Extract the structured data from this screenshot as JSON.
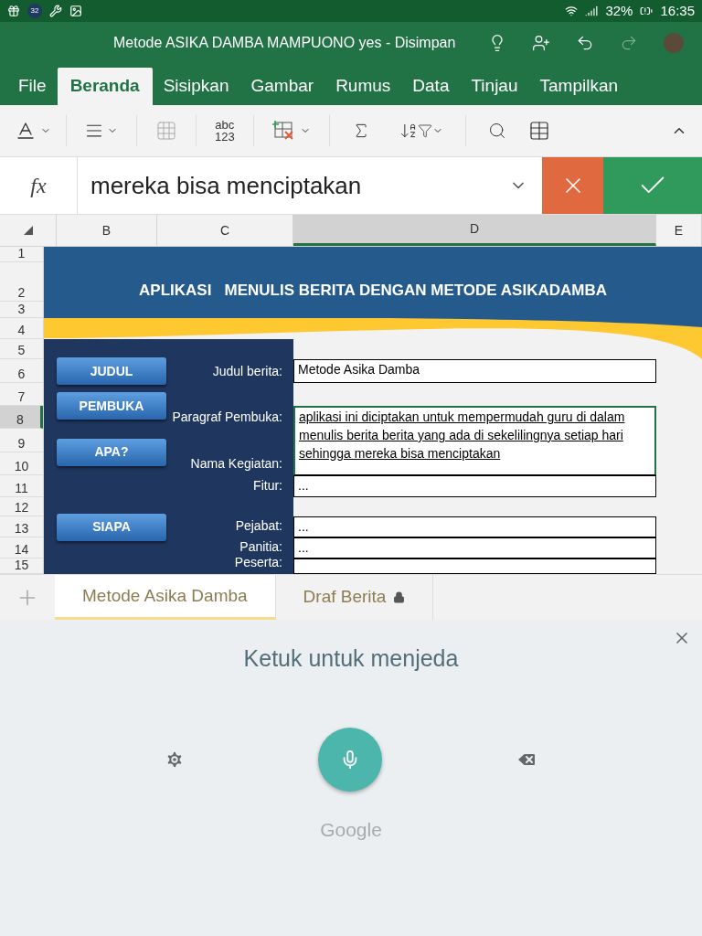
{
  "status_bar": {
    "notification_count": "32",
    "battery": "32%",
    "time": "16:35"
  },
  "title_bar": {
    "title": "Metode ASIKA DAMBA MAMPUONO yes - Disimpan"
  },
  "ribbon_tabs": [
    {
      "label": "File",
      "selected": false
    },
    {
      "label": "Beranda",
      "selected": true
    },
    {
      "label": "Sisipkan",
      "selected": false
    },
    {
      "label": "Gambar",
      "selected": false
    },
    {
      "label": "Rumus",
      "selected": false
    },
    {
      "label": "Data",
      "selected": false
    },
    {
      "label": "Tinjau",
      "selected": false
    },
    {
      "label": "Tampilkan",
      "selected": false
    }
  ],
  "toolbar": {
    "number_format_text": [
      "abc",
      "123"
    ]
  },
  "formula_bar": {
    "fx": "fx",
    "value": "mereka bisa menciptakan"
  },
  "column_headers": [
    {
      "label": "B",
      "selected": false
    },
    {
      "label": "C",
      "selected": false
    },
    {
      "label": "D",
      "selected": true
    },
    {
      "label": "E",
      "selected": false
    }
  ],
  "row_headers": [
    {
      "label": "1",
      "selected": false
    },
    {
      "label": "2",
      "selected": false
    },
    {
      "label": "3",
      "selected": false
    },
    {
      "label": "4",
      "selected": false
    },
    {
      "label": "5",
      "selected": false
    },
    {
      "label": "6",
      "selected": false
    },
    {
      "label": "7",
      "selected": false
    },
    {
      "label": "8",
      "selected": true
    },
    {
      "label": "9",
      "selected": false
    },
    {
      "label": "10",
      "selected": false
    },
    {
      "label": "11",
      "selected": false
    },
    {
      "label": "12",
      "selected": false
    },
    {
      "label": "13",
      "selected": false
    },
    {
      "label": "14",
      "selected": false
    },
    {
      "label": "15",
      "selected": false
    }
  ],
  "sheet": {
    "banner_title": "APLIKASI   MENULIS BERITA DENGAN METODE ASIKADAMBA",
    "buttons": [
      "JUDUL",
      "PEMBUKA",
      "APA?",
      "SIAPA"
    ],
    "fields": [
      {
        "label": "Judul berita:",
        "value": "Metode Asika Damba",
        "editing": false
      },
      {
        "label": "Paragraf Pembuka:",
        "value": "aplikasi ini diciptakan untuk mempermudah guru di dalam menulis berita berita yang ada di sekelilingnya setiap hari sehingga mereka bisa menciptakan",
        "editing": true
      },
      {
        "label": "Nama Kegiatan:"
      },
      {
        "label": "Fitur:",
        "value": "...",
        "editing": false
      },
      {
        "label": "Pejabat:",
        "value": "...",
        "editing": false
      },
      {
        "label": "Panitia:",
        "value": "...",
        "editing": false
      },
      {
        "label": "Peserta:",
        "editing": false
      }
    ]
  },
  "sheet_tabs": [
    {
      "label": "Metode Asika Damba",
      "selected": true,
      "locked": false
    },
    {
      "label": "Draf Berita",
      "selected": false,
      "locked": true
    }
  ],
  "voice_input": {
    "prompt": "Ketuk untuk menjeda",
    "brand": "Google"
  }
}
